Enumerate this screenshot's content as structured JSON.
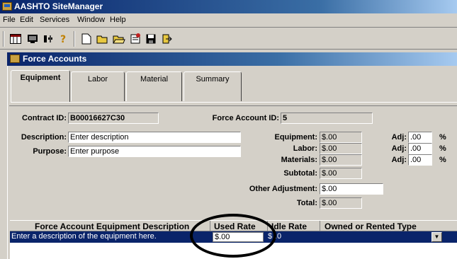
{
  "app": {
    "title": "AASHTO SiteManager"
  },
  "menu": [
    "File",
    "Edit",
    "Services",
    "Window",
    "Help"
  ],
  "toolbar_icons": [
    "grid-icon",
    "monitor-icon",
    "tools-icon",
    "help-icon",
    "new-document-icon",
    "open-folder-icon",
    "folder-icon",
    "notes-icon",
    "save-icon",
    "exit-icon"
  ],
  "child": {
    "title": "Force Accounts"
  },
  "tabs": [
    "Equipment",
    "Labor",
    "Material",
    "Summary"
  ],
  "form": {
    "contract_id_label": "Contract ID:",
    "contract_id": "B00016627C30",
    "force_account_id_label": "Force Account ID:",
    "force_account_id": "5",
    "description_label": "Description:",
    "description": "Enter description",
    "purpose_label": "Purpose:",
    "purpose": "Enter purpose",
    "equipment_label": "Equipment:",
    "equipment": "$.00",
    "labor_label": "Labor:",
    "labor": "$.00",
    "materials_label": "Materials:",
    "materials": "$.00",
    "subtotal_label": "Subtotal:",
    "subtotal": "$.00",
    "other_adjustment_label": "Other Adjustment:",
    "other_adjustment": "$.00",
    "total_label": "Total:",
    "total": "$.00",
    "adj_label": "Adj:",
    "adj_values": [
      ".00",
      ".00",
      ".00"
    ],
    "pct_symbol": "%"
  },
  "grid": {
    "columns": [
      "Force Account Equipment Description",
      "Used Rate",
      "Idle Rate",
      "Owned or Rented Type"
    ],
    "row": {
      "description": "Enter a description of the equipment here.",
      "used_rate": "$.00",
      "idle_rate_prefix": "$",
      "idle_rate_value": ".0",
      "type": ""
    }
  }
}
